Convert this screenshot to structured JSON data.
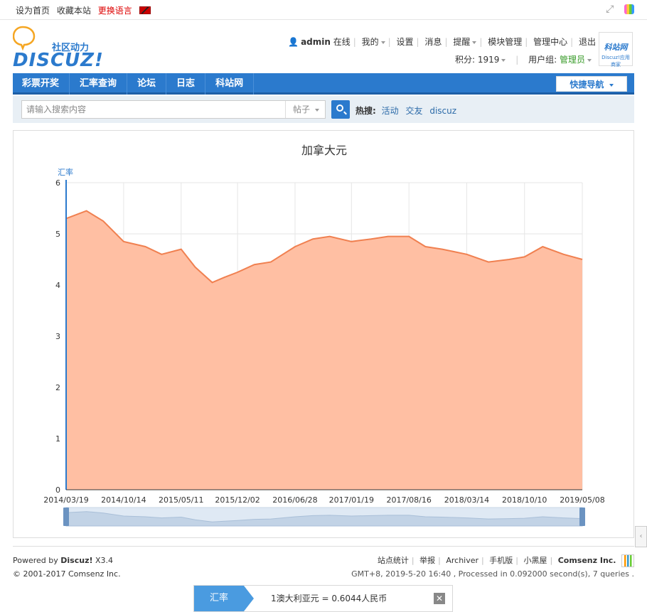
{
  "topbar": {
    "set_home": "设为首页",
    "favorite": "收藏本站",
    "change_lang": "更换语言"
  },
  "logo": {
    "subtitle": "社区动力",
    "name": "DISCUZ!"
  },
  "user": {
    "name": "admin",
    "status": "在线",
    "links": [
      "我的",
      "设置",
      "消息",
      "提醒",
      "模块管理",
      "管理中心",
      "退出"
    ],
    "points_label": "积分: 1919",
    "group_label": "用户组:",
    "group": "管理员"
  },
  "badge": {
    "title": "科站网",
    "sub": "Discuz!应用商家"
  },
  "nav": {
    "items": [
      "彩票开奖",
      "汇率查询",
      "论坛",
      "日志",
      "科站网"
    ],
    "quick": "快捷导航"
  },
  "search": {
    "placeholder": "请输入搜索内容",
    "type": "帖子",
    "hot_label": "热搜:",
    "hot_links": [
      "活动",
      "交友",
      "discuz"
    ]
  },
  "chart_data": {
    "type": "area",
    "title": "加拿大元",
    "ylabel": "汇率",
    "ylim": [
      0,
      6
    ],
    "yticks": [
      0,
      1,
      2,
      3,
      4,
      5,
      6
    ],
    "xticks": [
      "2014/03/19",
      "2014/10/14",
      "2015/05/11",
      "2015/12/02",
      "2016/06/28",
      "2017/01/19",
      "2017/08/16",
      "2018/03/14",
      "2018/10/10",
      "2019/05/08"
    ],
    "x": [
      "2014/03/19",
      "2014/06/01",
      "2014/08/01",
      "2014/10/14",
      "2015/01/01",
      "2015/03/01",
      "2015/05/11",
      "2015/07/01",
      "2015/09/01",
      "2015/10/15",
      "2015/12/02",
      "2016/02/01",
      "2016/04/01",
      "2016/06/28",
      "2016/09/01",
      "2016/11/01",
      "2017/01/19",
      "2017/04/01",
      "2017/06/01",
      "2017/08/16",
      "2017/10/15",
      "2017/12/15",
      "2018/03/14",
      "2018/06/01",
      "2018/08/15",
      "2018/10/10",
      "2018/12/15",
      "2019/03/01",
      "2019/05/08"
    ],
    "values": [
      5.3,
      5.45,
      5.25,
      4.85,
      4.75,
      4.6,
      4.7,
      4.35,
      4.05,
      4.15,
      4.25,
      4.4,
      4.45,
      4.75,
      4.9,
      4.95,
      4.85,
      4.9,
      4.95,
      4.95,
      4.75,
      4.7,
      4.6,
      4.45,
      4.5,
      4.55,
      4.75,
      4.6,
      4.5
    ],
    "grid": true,
    "legend": "none"
  },
  "footer": {
    "powered_by": "Powered by",
    "product": "Discuz!",
    "version": "X3.4",
    "copyright": "© 2001-2017 Comsenz Inc.",
    "links": [
      "站点统计",
      "举报",
      "Archiver",
      "手机版",
      "小黑屋"
    ],
    "company": "Comsenz Inc.",
    "process_info": "GMT+8, 2019-5-20 16:40 , Processed in 0.092000 second(s), 7 queries ."
  },
  "notice": {
    "tag": "汇率",
    "message": "1澳大利亚元 = 0.6044人民币"
  },
  "colors": {
    "brand": "#2b7acd",
    "area_fill": "#ffbfa3",
    "area_line": "#f08050",
    "navigator": "#dfe9f4"
  }
}
